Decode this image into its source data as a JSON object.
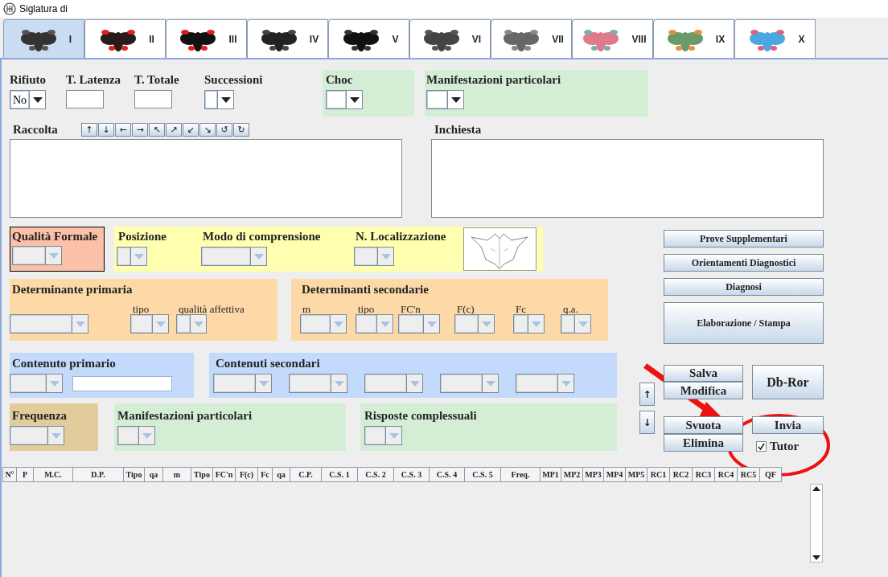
{
  "window": {
    "title": "Siglatura di"
  },
  "tabs": [
    {
      "label": "I",
      "selected": true
    },
    {
      "label": "II",
      "selected": false
    },
    {
      "label": "III",
      "selected": false
    },
    {
      "label": "IV",
      "selected": false
    },
    {
      "label": "V",
      "selected": false
    },
    {
      "label": "VI",
      "selected": false
    },
    {
      "label": "VII",
      "selected": false
    },
    {
      "label": "VIII",
      "selected": false
    },
    {
      "label": "IX",
      "selected": false
    },
    {
      "label": "X",
      "selected": false
    }
  ],
  "header_fields": [
    {
      "label": "Rifiuto",
      "kind": "combo",
      "value": "No",
      "disabled": false
    },
    {
      "label": "T. Latenza",
      "kind": "text"
    },
    {
      "label": "T. Totale",
      "kind": "text"
    },
    {
      "label": "Successioni",
      "kind": "combo",
      "disabled": false
    }
  ],
  "choc": {
    "label": "Choc",
    "combo": {
      "disabled": false
    }
  },
  "manifestazioni_top": {
    "label": "Manifestazioni particolari",
    "combo": {
      "disabled": false
    }
  },
  "raccolta": {
    "label": "Raccolta",
    "arrow_buttons": [
      "↑",
      "↓",
      "←",
      "→",
      "↖",
      "↗",
      "↙",
      "↘",
      "↺",
      "↻"
    ]
  },
  "inchiesta": {
    "label": "Inchiesta"
  },
  "qualita_formale": {
    "label": "Qualità Formale",
    "combo": {
      "disabled": true
    }
  },
  "localizzazione": [
    {
      "label": "Posizione",
      "disabled": true
    },
    {
      "label": "Modo di comprensione",
      "disabled": true
    },
    {
      "label": "N. Localizzazione",
      "disabled": true
    }
  ],
  "determinante_primaria": {
    "label": "Determinante primaria",
    "fields": [
      {
        "disabled": true
      },
      {
        "label": "tipo",
        "disabled": true
      },
      {
        "label": "qualità affettiva",
        "disabled": true
      }
    ]
  },
  "determinanti_secondarie": {
    "label": "Determinanti secondarie",
    "fields": [
      {
        "label": "m",
        "disabled": true
      },
      {
        "label": "tipo",
        "disabled": true
      },
      {
        "label": "FC'n",
        "disabled": true
      },
      {
        "label": "F(c)",
        "disabled": true
      },
      {
        "label": "Fc",
        "disabled": true
      },
      {
        "label": "q.a.",
        "disabled": true
      }
    ]
  },
  "contenuto_primario": {
    "label": "Contenuto primario",
    "combo": {
      "disabled": true
    }
  },
  "contenuti_secondari": {
    "label": "Contenuti secondari",
    "combos": [
      {
        "disabled": true
      },
      {
        "disabled": true
      },
      {
        "disabled": true
      },
      {
        "disabled": true
      },
      {
        "disabled": true
      }
    ]
  },
  "frequenza": {
    "label": "Frequenza",
    "combo": {
      "disabled": true
    }
  },
  "manifestazioni_bottom": {
    "label": "Manifestazioni particolari",
    "combo": {
      "disabled": true
    }
  },
  "risposte_complessuali": {
    "label": "Risposte complessuali",
    "combo": {
      "disabled": true
    }
  },
  "side_buttons": [
    "Prove Supplementari",
    "Orientamenti Diagnostici",
    "Diagnosi",
    "Elaborazione / Stampa"
  ],
  "nav_buttons": [
    "↑",
    "↓"
  ],
  "action_buttons": [
    "Salva",
    "Db-Ror",
    "Modifica",
    "Svuota",
    "Invia",
    "Elimina"
  ],
  "tutor": {
    "label": "Tutor",
    "checked": true
  },
  "table": {
    "columns": [
      "N°",
      "P",
      "M.C.",
      "D.P.",
      "Tipo",
      "qa",
      "m",
      "Tipo",
      "FC'n",
      "F(c)",
      "Fc",
      "qa",
      "C.P.",
      "C.S. 1",
      "C.S. 2",
      "C.S. 3",
      "C.S. 4",
      "C.S. 5",
      "Freq.",
      "MP1",
      "MP2",
      "MP3",
      "MP4",
      "MP5",
      "RC1",
      "RC2",
      "RC3",
      "RC4",
      "RC5",
      "QF"
    ]
  }
}
